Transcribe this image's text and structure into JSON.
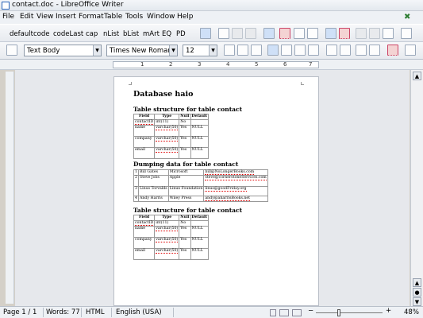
{
  "window": {
    "title": "contact.doc - LibreOffice Writer"
  },
  "menu": [
    "File",
    "Edit",
    "View",
    "Insert",
    "Format",
    "Table",
    "Tools",
    "Window",
    "Help"
  ],
  "toolbar1": {
    "macros": [
      "default",
      "code",
      "codeLast",
      "cap",
      "nList",
      "bList",
      "mArt",
      "EQ",
      "PD"
    ]
  },
  "toolbar2": {
    "style": "Text Body",
    "font": "Times New Roman",
    "size": "12"
  },
  "ruler": {
    "numbers": [
      "1",
      "2",
      "3",
      "4",
      "5",
      "6",
      "7"
    ]
  },
  "document": {
    "heading": "Database haio",
    "sections": [
      {
        "title": "Table structure for table contact",
        "headers": [
          "Field",
          "Type",
          "Null",
          "Default"
        ],
        "rows": [
          [
            "contactID",
            "int(11)",
            "No",
            ""
          ],
          [
            "name",
            "varchar(50)",
            "Yes",
            "NULL"
          ],
          [
            "company",
            "varchar(50)",
            "Yes",
            "NULL"
          ],
          [
            "email",
            "varchar(50)",
            "Yes",
            "NULL"
          ]
        ]
      },
      {
        "title": "Dumping data for table contact",
        "rows": [
          [
            "1",
            "Bill Gates",
            "Microsoft",
            "bill@NoLongerBooks.com"
          ],
          [
            "2",
            "Steve Jobs",
            "Apple",
            "steve@cornerstoneServices.com"
          ],
          [
            "3",
            "Linus Torvalds",
            "Linux Foundation",
            "linus@goodFriday.org"
          ],
          [
            "4",
            "Andy Harris",
            "Wiley Press",
            "andy@aharrisBooks.net"
          ]
        ]
      },
      {
        "title": "Table structure for table contact",
        "headers": [
          "Field",
          "Type",
          "Null",
          "Default"
        ],
        "rows": [
          [
            "contactID",
            "int(11)",
            "No",
            ""
          ],
          [
            "name",
            "varchar(50)",
            "Yes",
            "NULL"
          ],
          [
            "company",
            "varchar(50)",
            "Yes",
            "NULL"
          ],
          [
            "email",
            "varchar(50)",
            "Yes",
            "NULL"
          ]
        ]
      }
    ]
  },
  "status": {
    "page": "Page 1 / 1",
    "words": "Words: 77",
    "mode": "HTML",
    "language": "English (USA)",
    "zoom": "48%"
  }
}
